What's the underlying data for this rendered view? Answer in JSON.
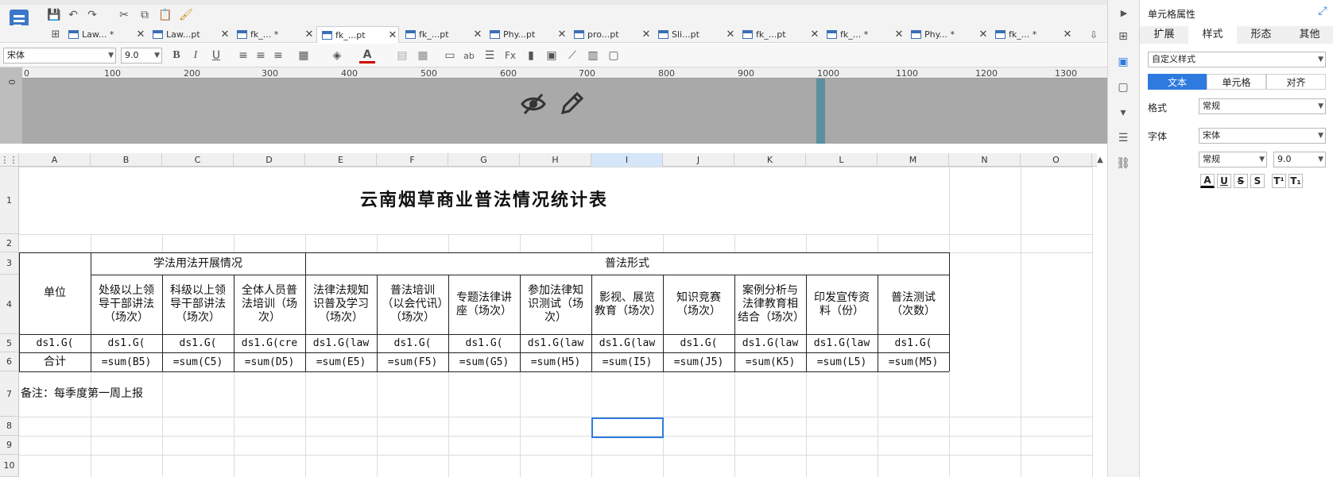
{
  "tabs": [
    {
      "label": "Law... *"
    },
    {
      "label": "Law...pt"
    },
    {
      "label": "fk_... *"
    },
    {
      "label": "fk_...pt"
    },
    {
      "label": "fk_...pt"
    },
    {
      "label": "Phy...pt"
    },
    {
      "label": "pro...pt"
    },
    {
      "label": "Sli...pt"
    },
    {
      "label": "fk_...pt"
    },
    {
      "label": "fk_... *"
    },
    {
      "label": "Phy... *"
    },
    {
      "label": "fk_... *"
    }
  ],
  "font": {
    "family": "宋体",
    "size": "9.0"
  },
  "ruler": {
    "ticks": [
      "0",
      "100",
      "200",
      "300",
      "400",
      "500",
      "600",
      "700",
      "800",
      "900",
      "1000",
      "1100",
      "1200",
      "1300"
    ]
  },
  "columns": [
    "A",
    "B",
    "C",
    "D",
    "E",
    "F",
    "G",
    "H",
    "I",
    "J",
    "K",
    "L",
    "M",
    "N",
    "O"
  ],
  "rows": [
    "1",
    "2",
    "3",
    "4",
    "5",
    "6",
    "7",
    "8",
    "9",
    "10"
  ],
  "sheet": {
    "title": "云南烟草商业普法情况统计表",
    "unit_header": "单位",
    "group1": "学法用法开展情况",
    "group2": "普法形式",
    "subheaders": [
      "处级以上领导干部讲法（场次）",
      "科级以上领导干部讲法（场次）",
      "全体人员普法培训（场次）",
      "法律法规知识普及学习（场次）",
      "普法培训（以会代讯）（场次）",
      "专题法律讲座（场次）",
      "参加法律知识测试（场次）",
      "影视、展览教育（场次）",
      "知识竞赛（场次）",
      "案例分析与法律教育相结合（场次）",
      "印发宣传资料（份）",
      "普法测试（次数）"
    ],
    "row5": [
      "ds1.G(",
      "ds1.G(",
      "ds1.G(",
      "ds1.G(cre",
      "ds1.G(law",
      "ds1.G(",
      "ds1.G(",
      "ds1.G(law",
      "ds1.G(law",
      "ds1.G(",
      "ds1.G(law",
      "ds1.G(law",
      "ds1.G("
    ],
    "row6": [
      "合计",
      "=sum(B5)",
      "=sum(C5)",
      "=sum(D5)",
      "=sum(E5)",
      "=sum(F5)",
      "=sum(G5)",
      "=sum(H5)",
      "=sum(I5)",
      "=sum(J5)",
      "=sum(K5)",
      "=sum(L5)",
      "=sum(M5)"
    ],
    "note": "备注：每季度第一周上报"
  },
  "panel": {
    "title": "单元格属性",
    "tabs": [
      "扩展",
      "样式",
      "形态",
      "其他"
    ],
    "style_select": "自定义样式",
    "segments": [
      "文本",
      "单元格",
      "对齐"
    ],
    "format_label": "格式",
    "format_value": "常规",
    "font_label": "字体",
    "font_value": "宋体",
    "font_style": "常规",
    "font_size": "9.0",
    "format_buttons": [
      "A",
      "U",
      "S",
      "S",
      "T¹",
      "T₁"
    ]
  },
  "colors": {
    "accent": "#2e7be0",
    "hidden_band": "#a9a9a9"
  }
}
